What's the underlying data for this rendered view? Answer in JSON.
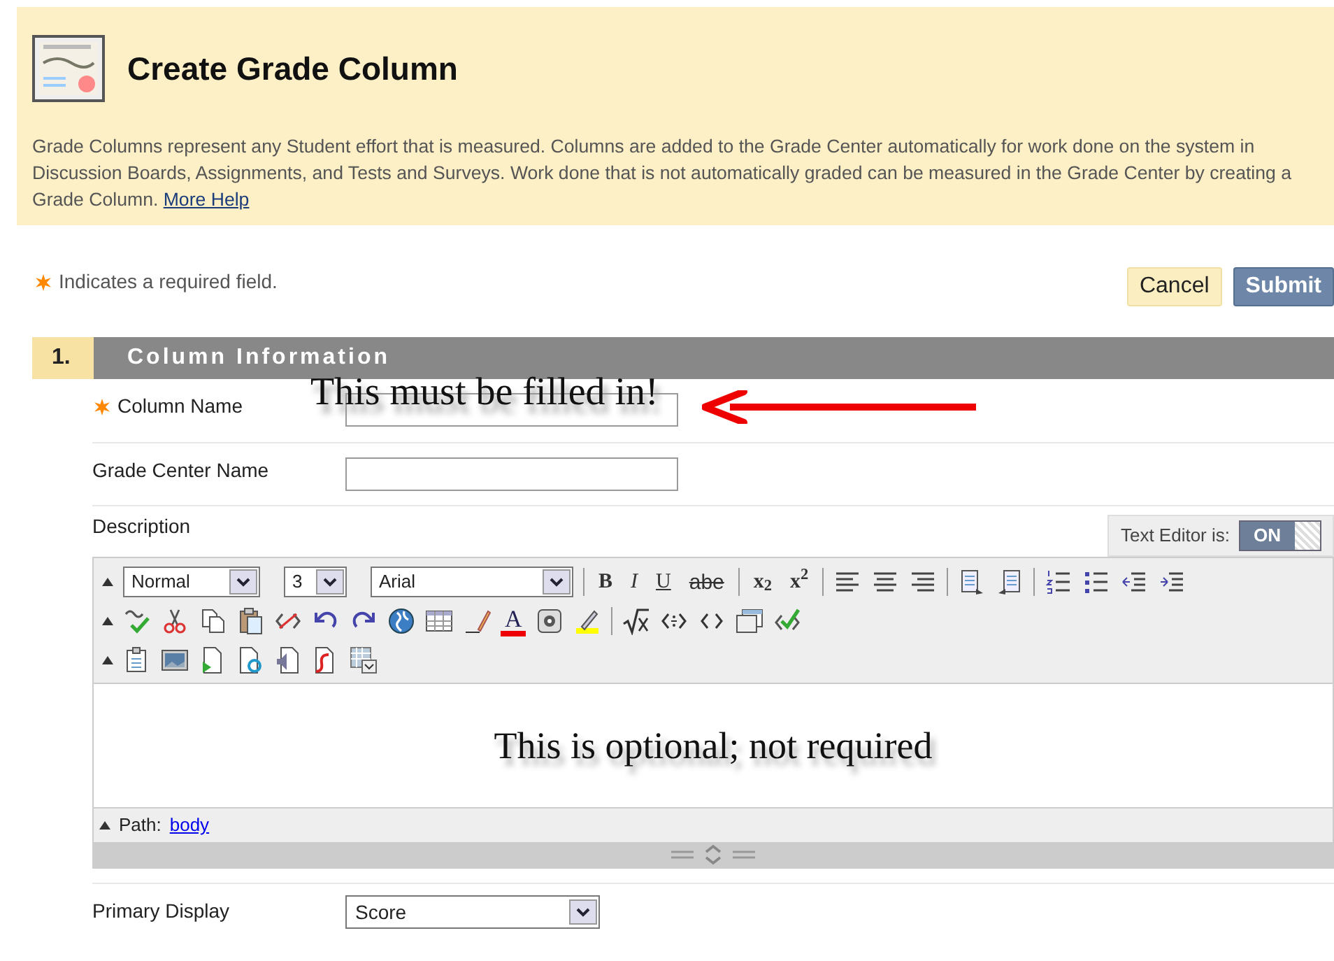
{
  "header": {
    "title": "Create Grade Column",
    "description": "Grade Columns represent any Student effort that is measured. Columns are added to the Grade Center automatically for work done on the system in Discussion Boards, Assignments, and Tests and Surveys. Work done that is not automatically graded can be measured in the Grade Center by creating a Grade Column.",
    "help_link": "More Help"
  },
  "required_note": "Indicates a required field.",
  "buttons": [
    {
      "label": "Cancel",
      "kind": "secondary"
    },
    {
      "label": "Submit",
      "kind": "primary"
    }
  ],
  "section": {
    "number": "1.",
    "title": "Column Information"
  },
  "fields": [
    {
      "kind": "text",
      "label": "Column Name",
      "required": true,
      "annotation": "This must be filled in!"
    },
    {
      "kind": "text",
      "label": "Grade Center Name",
      "required": false
    },
    {
      "kind": "editor",
      "label": "Description",
      "required": false,
      "toggle": {
        "label": "Text Editor is:",
        "text": "ON",
        "on": true
      },
      "toolbar": [
        [
          {
            "kind": "dropdown",
            "value": "Normal"
          },
          {
            "kind": "dropdown",
            "value": "3"
          },
          {
            "kind": "dropdown",
            "value": "Arial"
          },
          {
            "kind": "separator"
          },
          {
            "kind": "glyph",
            "label": "B"
          },
          {
            "kind": "glyph",
            "label": "I"
          },
          {
            "kind": "glyph",
            "label": "U"
          },
          {
            "kind": "glyph",
            "label": "abe"
          },
          {
            "kind": "separator"
          },
          {
            "kind": "glyph",
            "label": "x$_{2}$"
          },
          {
            "kind": "glyph",
            "label": "x$^{2}$"
          },
          {
            "kind": "separator"
          },
          {
            "kind": "icon"
          },
          {
            "kind": "icon"
          },
          {
            "kind": "icon"
          },
          {
            "kind": "separator"
          },
          {
            "kind": "icon"
          },
          {
            "kind": "icon"
          },
          {
            "kind": "separator"
          },
          {
            "kind": "icon"
          },
          {
            "kind": "icon"
          },
          {
            "kind": "icon"
          },
          {
            "kind": "icon"
          }
        ],
        [
          {
            "kind": "icon"
          },
          {
            "kind": "icon"
          },
          {
            "kind": "icon"
          },
          {
            "kind": "icon"
          },
          {
            "kind": "icon"
          },
          {
            "kind": "icon"
          },
          {
            "kind": "icon"
          },
          {
            "kind": "icon"
          },
          {
            "kind": "icon"
          },
          {
            "kind": "icon"
          },
          {
            "kind": "glyph",
            "label": "A"
          },
          {
            "kind": "icon"
          },
          {
            "kind": "icon"
          },
          {
            "kind": "separator"
          },
          {
            "kind": "icon"
          },
          {
            "kind": "icon"
          },
          {
            "kind": "icon"
          },
          {
            "kind": "icon"
          },
          {
            "kind": "icon"
          }
        ],
        [
          {
            "kind": "icon"
          },
          {
            "kind": "icon"
          },
          {
            "kind": "icon"
          },
          {
            "kind": "icon"
          },
          {
            "kind": "icon"
          },
          {
            "kind": "icon"
          },
          {
            "kind": "icon"
          }
        ]
      ],
      "annotation": "This is optional; not required",
      "path_label": "Path:",
      "path_link": "body"
    },
    {
      "kind": "select",
      "label": "Primary Display",
      "required": false,
      "value": "Score"
    }
  ]
}
